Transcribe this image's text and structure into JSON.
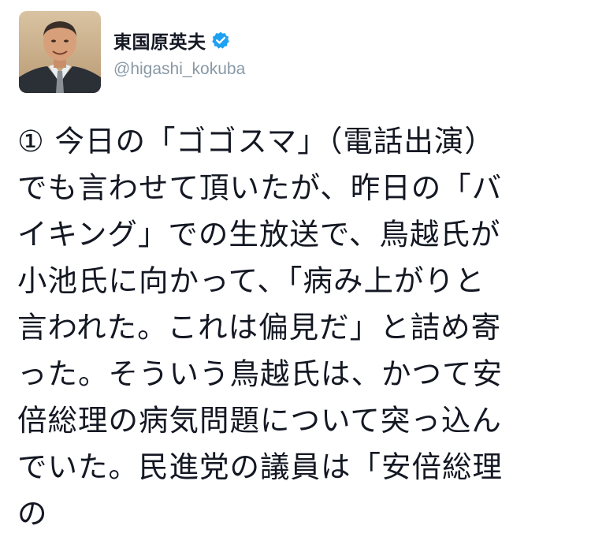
{
  "user": {
    "display_name": "東国原英夫",
    "handle": "@higashi_kokuba",
    "verified": true,
    "verified_icon": "verified-badge-icon",
    "verified_color": "#1da1f2"
  },
  "tweet": {
    "text": "① 今日の「ゴゴスマ」（電話出演）\nでも言わせて頂いたが、昨日の「バ\nイキング」での生放送で、鳥越氏が\n小池氏に向かって、「病み上がりと\n言われた。これは偏見だ」と詰め寄\nった。そういう鳥越氏は、かつて安\n倍総理の病気問題について突っ込ん\nでいた。民進党の議員は「安倍総理\nの"
  }
}
